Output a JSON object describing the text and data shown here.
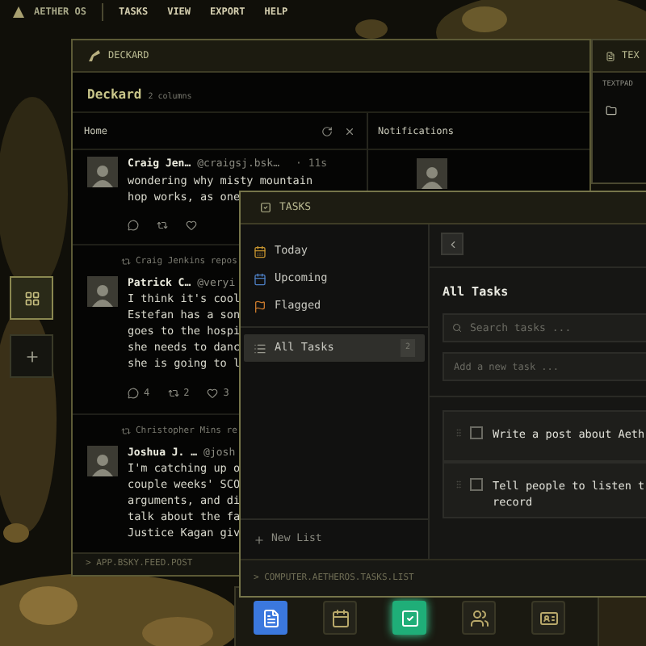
{
  "menubar": {
    "brand": "AETHER OS",
    "menus": [
      "TASKS",
      "VIEW",
      "EXPORT",
      "HELP"
    ]
  },
  "left_dock": [
    {
      "kind": "app",
      "selected": true
    },
    {
      "kind": "add",
      "selected": false
    }
  ],
  "deckard": {
    "title": "DECKARD",
    "heading": "Deckard",
    "subheading": "2 columns",
    "home": {
      "title": "Home",
      "posts": [
        {
          "name": "Craig Jen…",
          "handle": "@craigsj.bsk…",
          "time": "· 11s",
          "lines": [
            "wondering why misty mountain",
            "hop works, as one"
          ]
        },
        {
          "repost_by": "Craig Jenkins repos",
          "name": "Patrick C…",
          "handle": "@veryi",
          "lines": [
            "I think it's cool",
            "Estefan has a son",
            "goes to the hospi",
            "she needs to danc",
            "she is going to l"
          ],
          "replies": "4",
          "reposts": "2",
          "likes": "3"
        },
        {
          "repost_by": "Christopher Mins re",
          "name": "Joshua J. …",
          "handle": "@josh",
          "lines": [
            "I'm catching up o",
            "couple weeks' SCO",
            "arguments, and di",
            "talk about the fa",
            "Justice Kagan giv"
          ]
        }
      ]
    },
    "notifications": {
      "title": "Notifications"
    },
    "footer": "> APP.BSKY.FEED.POST"
  },
  "textpad": {
    "title": "TEX",
    "label": "TEXTPAD"
  },
  "tasks": {
    "title": "TASKS",
    "lists": [
      {
        "kind": "today",
        "label": "Today",
        "color": "#c9962f",
        "selected": false
      },
      {
        "kind": "upcoming",
        "label": "Upcoming",
        "color": "#4d7fc4",
        "selected": false
      },
      {
        "kind": "flagged",
        "label": "Flagged",
        "color": "#c8782c",
        "selected": false
      },
      {
        "kind": "all",
        "label": "All Tasks",
        "count": "2",
        "selected": true
      }
    ],
    "new_list": "New List",
    "heading": "All Tasks",
    "search": {
      "placeholder": "Search tasks ..."
    },
    "add": {
      "placeholder": "Add a new task ..."
    },
    "items": [
      {
        "lines": [
          "Write a post about Aeth"
        ],
        "checked": false
      },
      {
        "lines": [
          "Tell people to listen t",
          "record"
        ],
        "checked": false
      }
    ],
    "footer": "> COMPUTER.AETHEROS.TASKS.LIST"
  },
  "dock": [
    {
      "kind": "textpad",
      "color": "#3b78de",
      "selected": false
    },
    {
      "kind": "calendar",
      "selected": false
    },
    {
      "kind": "tasks",
      "color": "#1fae78",
      "selected": true
    },
    {
      "kind": "people",
      "selected": false
    },
    {
      "kind": "id",
      "selected": false
    }
  ]
}
